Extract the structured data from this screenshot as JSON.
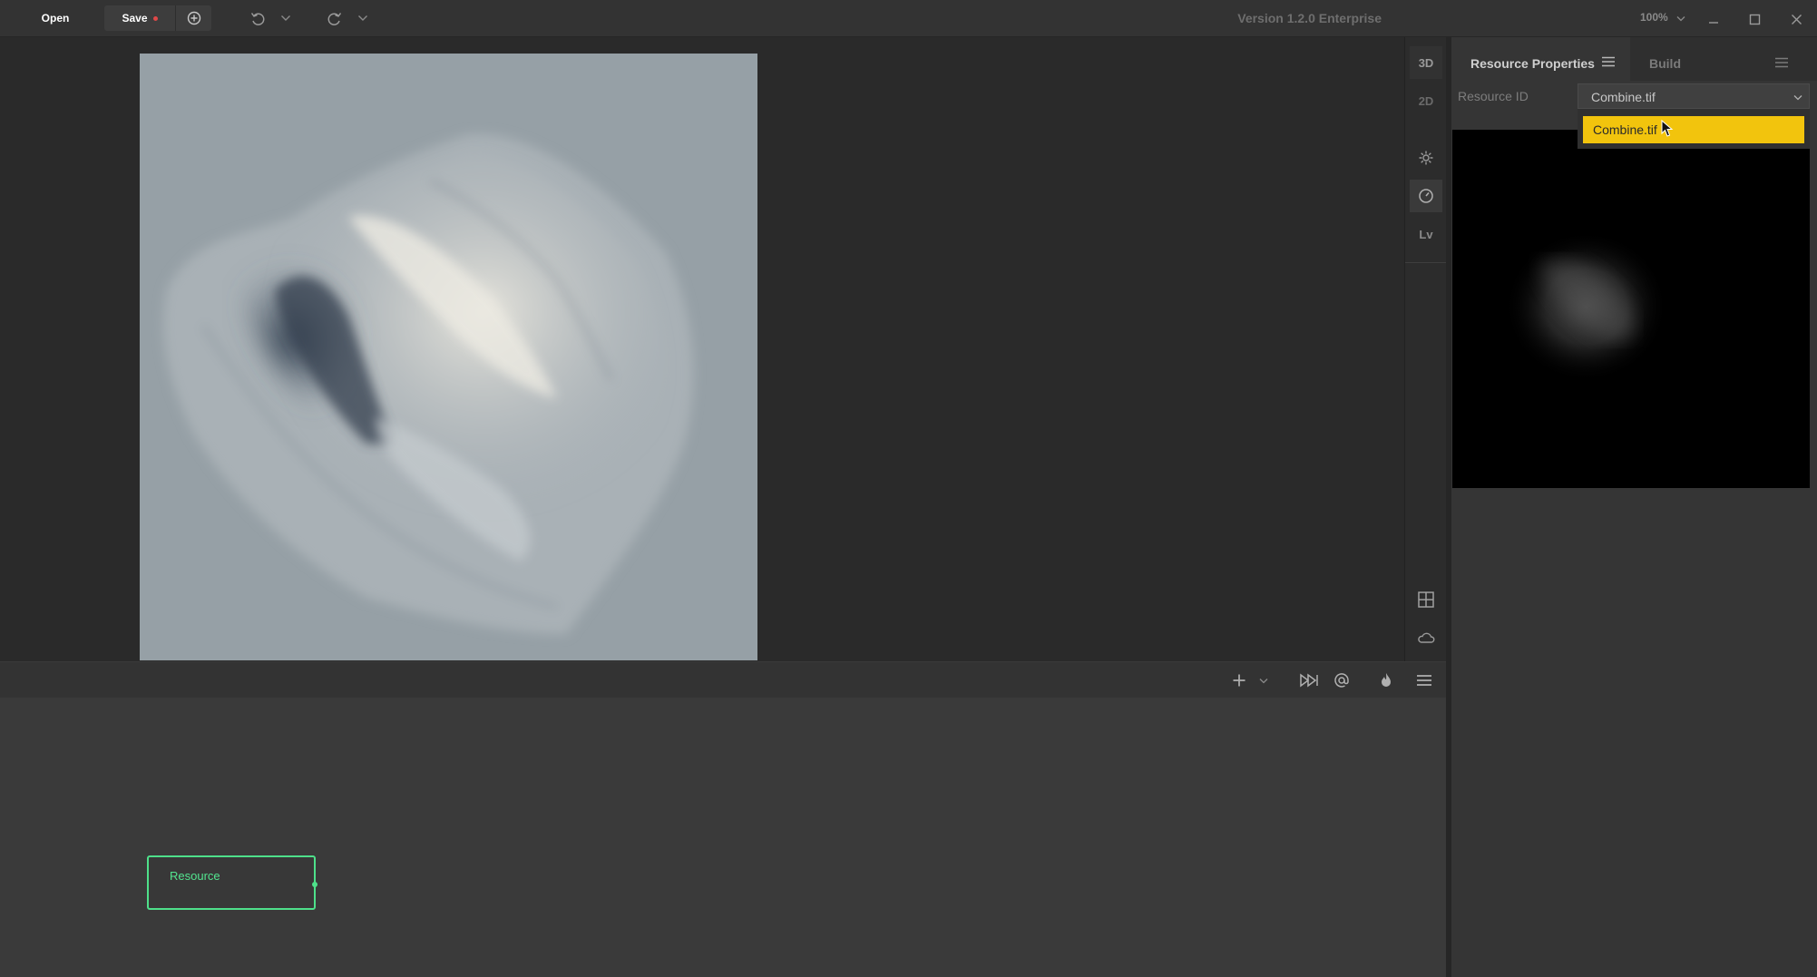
{
  "toolbar": {
    "open_label": "Open",
    "save_label": "Save",
    "version_label": "Version 1.2.0 Enterprise",
    "zoom_label": "100%",
    "icons": [
      "add-circle-icon",
      "undo-icon",
      "chevron-down-icon",
      "redo-icon",
      "chevron-down-icon",
      "minimize-icon",
      "maximize-icon",
      "close-icon"
    ]
  },
  "viewport_tools": {
    "view_3d_label": "3D",
    "view_2d_label": "2D",
    "level_label": "Lv",
    "icons": [
      "light-icon",
      "compass-icon",
      "grid-icon",
      "cloud-icon"
    ]
  },
  "graph_toolbar": {
    "icons": [
      "add-icon",
      "chevron-down-icon",
      "fast-forward-icon",
      "at-icon",
      "flame-icon",
      "menu-icon"
    ]
  },
  "graph": {
    "node_label": "Resource",
    "node_color": "#4ee08a"
  },
  "properties": {
    "tabs": [
      {
        "label": "Resource Properties",
        "active": true
      },
      {
        "label": "Build",
        "active": false
      }
    ],
    "resource_id_label": "Resource ID",
    "resource_id_value": "Combine.tif",
    "dropdown_options": [
      "Combine.tif"
    ],
    "highlight_color": "#f2c40d"
  }
}
